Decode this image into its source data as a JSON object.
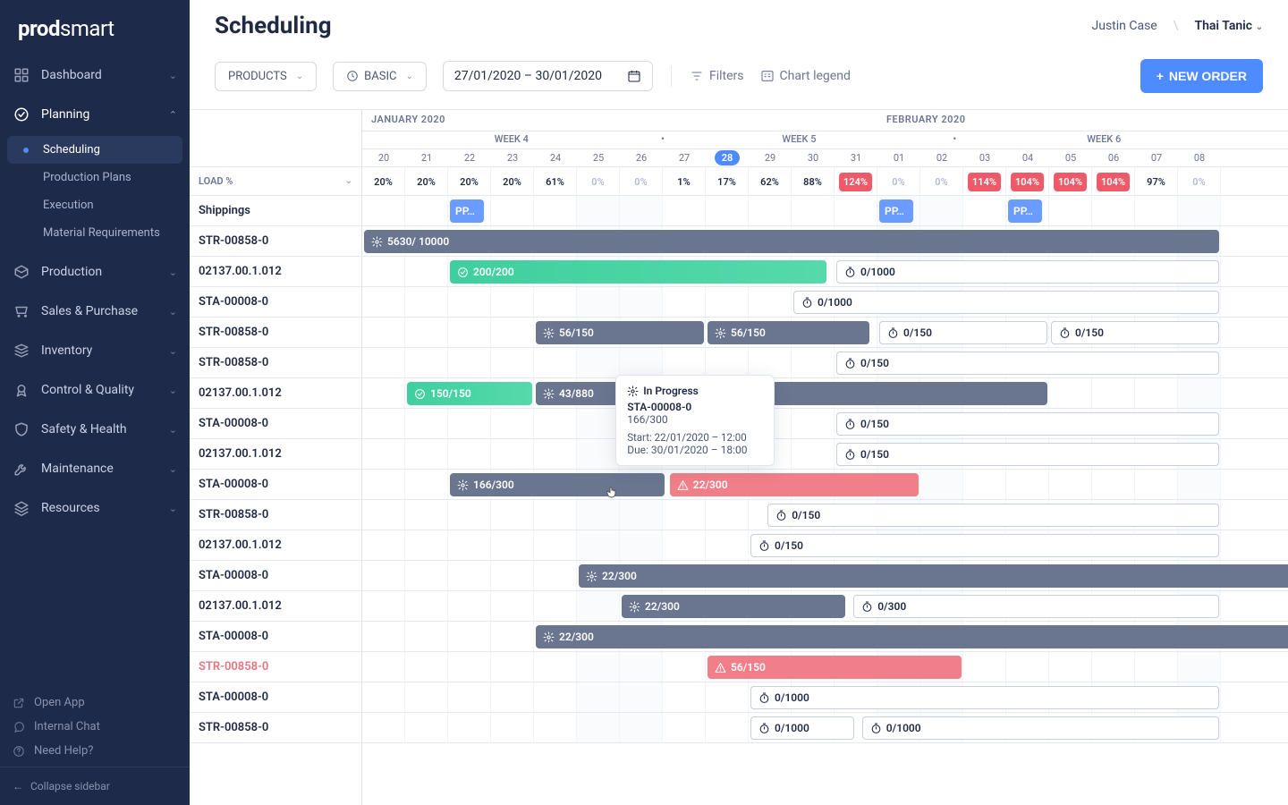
{
  "brand": {
    "name1": "prod",
    "name2": "smart"
  },
  "header": {
    "title": "Scheduling",
    "user": "Justin Case",
    "org": "Thai Tanic"
  },
  "toolbar": {
    "products": "PRODUCTS",
    "basic": "BASIC",
    "date_range": "27/01/2020 – 30/01/2020",
    "filters": "Filters",
    "chart_legend": "Chart legend",
    "new_order": "NEW ORDER"
  },
  "sidebar": {
    "items": [
      {
        "label": "Dashboard",
        "icon": "grid"
      },
      {
        "label": "Planning",
        "icon": "check",
        "expanded": true,
        "children": [
          {
            "label": "Scheduling",
            "active": true
          },
          {
            "label": "Production Plans"
          },
          {
            "label": "Execution"
          },
          {
            "label": "Material Requirements"
          }
        ]
      },
      {
        "label": "Production",
        "icon": "box"
      },
      {
        "label": "Sales & Purchase",
        "icon": "cart"
      },
      {
        "label": "Inventory",
        "icon": "stack"
      },
      {
        "label": "Control & Quality",
        "icon": "badge"
      },
      {
        "label": "Safety & Health",
        "icon": "shield"
      },
      {
        "label": "Maintenance",
        "icon": "tool"
      },
      {
        "label": "Resources",
        "icon": "layers"
      }
    ],
    "footer": [
      {
        "label": "Open App",
        "icon": "external"
      },
      {
        "label": "Internal Chat",
        "icon": "chat"
      },
      {
        "label": "Need Help?",
        "icon": "help"
      }
    ],
    "collapse": "Collapse sidebar"
  },
  "timeline": {
    "months": [
      {
        "label": "JANUARY 2020",
        "span": 12
      },
      {
        "label": "FEBRUARY 2020",
        "span": 8
      }
    ],
    "weeks": [
      {
        "label": "WEEK 4",
        "center": 3.6
      },
      {
        "label": "WEEK 5",
        "center": 10.3
      },
      {
        "label": "WEEK 6",
        "center": 17.4
      }
    ],
    "days": [
      "20",
      "21",
      "22",
      "23",
      "24",
      "25",
      "26",
      "27",
      "28",
      "29",
      "30",
      "31",
      "01",
      "02",
      "03",
      "04",
      "05",
      "06",
      "07",
      "08"
    ],
    "today_index": 8,
    "weekend_cols": [
      [
        5,
        6
      ],
      [
        12,
        13
      ],
      [
        19,
        19
      ]
    ],
    "load_label": "LOAD %",
    "loads": [
      {
        "v": "20%"
      },
      {
        "v": "20%"
      },
      {
        "v": "20%"
      },
      {
        "v": "20%"
      },
      {
        "v": "61%"
      },
      {
        "v": "0%",
        "z": true
      },
      {
        "v": "0%",
        "z": true
      },
      {
        "v": "1%"
      },
      {
        "v": "17%"
      },
      {
        "v": "62%"
      },
      {
        "v": "88%"
      },
      {
        "v": "124%",
        "o": true
      },
      {
        "v": "0%",
        "z": true
      },
      {
        "v": "0%",
        "z": true
      },
      {
        "v": "114%",
        "o": true
      },
      {
        "v": "104%",
        "o": true
      },
      {
        "v": "104%",
        "o": true
      },
      {
        "v": "104%",
        "o": true
      },
      {
        "v": "97%"
      },
      {
        "v": "0%",
        "z": true
      }
    ]
  },
  "rows": [
    {
      "label": "Shippings",
      "bars": [
        {
          "text": "PP…",
          "kind": "blue chip",
          "from": 2,
          "span": 0.88
        },
        {
          "text": "PP…",
          "kind": "blue chip",
          "from": 12,
          "span": 0.88
        },
        {
          "text": "PP…",
          "kind": "blue chip",
          "from": 15,
          "span": 0.88
        }
      ]
    },
    {
      "label": "STR-00858-0",
      "bars": [
        {
          "text": "5630/ 10000",
          "kind": "gray",
          "icon": "gear",
          "from": 0,
          "span": 20
        }
      ]
    },
    {
      "label": "02137.00.1.012",
      "bars": [
        {
          "text": "200/200",
          "kind": "green",
          "icon": "check",
          "from": 2,
          "span": 8.85
        },
        {
          "text": "0/1000",
          "kind": "outline",
          "icon": "timer",
          "from": 11,
          "span": 9
        }
      ]
    },
    {
      "label": "STA-00008-0",
      "bars": [
        {
          "text": "0/1000",
          "kind": "outline",
          "icon": "timer",
          "from": 10,
          "span": 10
        }
      ]
    },
    {
      "label": "STR-00858-0",
      "bars": [
        {
          "text": "56/150",
          "kind": "gray",
          "icon": "gear",
          "from": 4,
          "span": 4
        },
        {
          "text": "56/150",
          "kind": "gray",
          "icon": "gear",
          "from": 8,
          "span": 3.85
        },
        {
          "text": "0/150",
          "kind": "outline",
          "icon": "timer",
          "from": 12,
          "span": 4
        },
        {
          "text": "0/150",
          "kind": "outline",
          "icon": "timer",
          "from": 16,
          "span": 4
        }
      ]
    },
    {
      "label": "STR-00858-0",
      "bars": [
        {
          "text": "0/150",
          "kind": "outline",
          "icon": "timer",
          "from": 11,
          "span": 9
        }
      ]
    },
    {
      "label": "02137.00.1.012",
      "bars": [
        {
          "text": "150/150",
          "kind": "green",
          "icon": "check",
          "from": 1,
          "span": 3
        },
        {
          "text": "43/880",
          "kind": "gray",
          "icon": "gear",
          "from": 4,
          "span": 12
        }
      ]
    },
    {
      "label": "STA-00008-0",
      "bars": [
        {
          "text": "0/150",
          "kind": "outline",
          "icon": "timer",
          "from": 11,
          "span": 9
        }
      ]
    },
    {
      "label": "02137.00.1.012",
      "bars": [
        {
          "text": "0/150",
          "kind": "outline",
          "icon": "timer",
          "from": 11,
          "span": 9
        }
      ]
    },
    {
      "label": "STA-00008-0",
      "bars": [
        {
          "text": "166/300",
          "kind": "gray",
          "icon": "gear",
          "from": 2,
          "span": 5.08
        },
        {
          "text": "22/300",
          "kind": "red",
          "icon": "alert",
          "from": 7.12,
          "span": 5.88
        }
      ]
    },
    {
      "label": "STR-00858-0",
      "bars": [
        {
          "text": "0/150",
          "kind": "outline",
          "icon": "timer",
          "from": 9.4,
          "span": 10.6
        }
      ]
    },
    {
      "label": "02137.00.1.012",
      "bars": [
        {
          "text": "0/150",
          "kind": "outline",
          "icon": "timer",
          "from": 9,
          "span": 11
        }
      ]
    },
    {
      "label": "STA-00008-0",
      "bars": [
        {
          "text": "22/300",
          "kind": "gray",
          "icon": "gear",
          "from": 5,
          "span": 17
        }
      ]
    },
    {
      "label": "02137.00.1.012",
      "bars": [
        {
          "text": "22/300",
          "kind": "gray",
          "icon": "gear",
          "from": 6,
          "span": 5.3
        },
        {
          "text": "0/300",
          "kind": "outline",
          "icon": "timer",
          "from": 11.4,
          "span": 8.6
        }
      ]
    },
    {
      "label": "STA-00008-0",
      "bars": [
        {
          "text": "22/300",
          "kind": "gray",
          "icon": "gear",
          "from": 4,
          "span": 18
        }
      ]
    },
    {
      "label": "STR-00858-0",
      "alert": true,
      "bars": [
        {
          "text": "56/150",
          "kind": "red",
          "icon": "alert",
          "from": 8,
          "span": 6
        }
      ]
    },
    {
      "label": "STA-00008-0",
      "bars": [
        {
          "text": "0/1000",
          "kind": "outline",
          "icon": "timer",
          "from": 9,
          "span": 11
        }
      ]
    },
    {
      "label": "STR-00858-0",
      "bars": [
        {
          "text": "0/1000",
          "kind": "outline",
          "icon": "timer",
          "from": 9,
          "span": 2.5
        },
        {
          "text": "0/1000",
          "kind": "outline",
          "icon": "timer",
          "from": 11.6,
          "span": 8.4
        }
      ]
    }
  ],
  "tooltip": {
    "status": "In Progress",
    "code": "STA-00008-0",
    "ratio": "166/300",
    "start": "Start: 22/01/2020 – 12:00",
    "due": "Due: 30/01/2020 – 18:00",
    "row": 9,
    "col": 5.9
  }
}
